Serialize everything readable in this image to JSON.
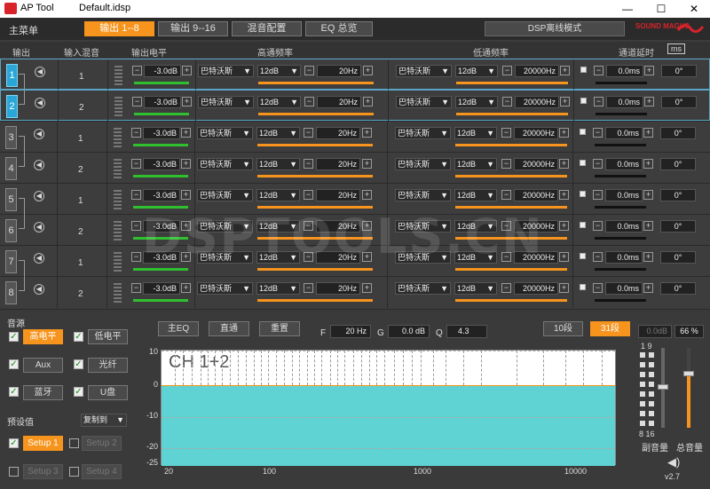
{
  "app": {
    "name": "AP Tool",
    "file": "Default.idsp"
  },
  "window": {
    "min": "—",
    "max": "☐",
    "close": "✕"
  },
  "menu": {
    "main": "主菜单",
    "tabs": [
      "输出 1--8",
      "输出 9--16",
      "混音配置",
      "EQ 总览"
    ],
    "dsp_mode": "DSP离线模式",
    "brand": "SOUND MAGUS"
  },
  "headers": {
    "out": "输出",
    "mix": "输入混音",
    "level": "输出电平",
    "hp": "高通频率",
    "lp": "低通频率",
    "delay": "通道延时",
    "unit": "ms"
  },
  "rows": [
    {
      "ch": "1",
      "mix": "1",
      "level": "-3.0dB",
      "hp_type": "巴特沃斯",
      "hp_slope": "12dB",
      "hp_freq": "20Hz",
      "lp_type": "巴特沃斯",
      "lp_slope": "12dB",
      "lp_freq": "20000Hz",
      "delay": "0.0ms",
      "phase": "0°"
    },
    {
      "ch": "2",
      "mix": "2",
      "level": "-3.0dB",
      "hp_type": "巴特沃斯",
      "hp_slope": "12dB",
      "hp_freq": "20Hz",
      "lp_type": "巴特沃斯",
      "lp_slope": "12dB",
      "lp_freq": "20000Hz",
      "delay": "0.0ms",
      "phase": "0°"
    },
    {
      "ch": "3",
      "mix": "1",
      "level": "-3.0dB",
      "hp_type": "巴特沃斯",
      "hp_slope": "12dB",
      "hp_freq": "20Hz",
      "lp_type": "巴特沃斯",
      "lp_slope": "12dB",
      "lp_freq": "20000Hz",
      "delay": "0.0ms",
      "phase": "0°"
    },
    {
      "ch": "4",
      "mix": "2",
      "level": "-3.0dB",
      "hp_type": "巴特沃斯",
      "hp_slope": "12dB",
      "hp_freq": "20Hz",
      "lp_type": "巴特沃斯",
      "lp_slope": "12dB",
      "lp_freq": "20000Hz",
      "delay": "0.0ms",
      "phase": "0°"
    },
    {
      "ch": "5",
      "mix": "1",
      "level": "-3.0dB",
      "hp_type": "巴特沃斯",
      "hp_slope": "12dB",
      "hp_freq": "20Hz",
      "lp_type": "巴特沃斯",
      "lp_slope": "12dB",
      "lp_freq": "20000Hz",
      "delay": "0.0ms",
      "phase": "0°"
    },
    {
      "ch": "6",
      "mix": "2",
      "level": "-3.0dB",
      "hp_type": "巴特沃斯",
      "hp_slope": "12dB",
      "hp_freq": "20Hz",
      "lp_type": "巴特沃斯",
      "lp_slope": "12dB",
      "lp_freq": "20000Hz",
      "delay": "0.0ms",
      "phase": "0°"
    },
    {
      "ch": "7",
      "mix": "1",
      "level": "-3.0dB",
      "hp_type": "巴特沃斯",
      "hp_slope": "12dB",
      "hp_freq": "20Hz",
      "lp_type": "巴特沃斯",
      "lp_slope": "12dB",
      "lp_freq": "20000Hz",
      "delay": "0.0ms",
      "phase": "0°"
    },
    {
      "ch": "8",
      "mix": "2",
      "level": "-3.0dB",
      "hp_type": "巴特沃斯",
      "hp_slope": "12dB",
      "hp_freq": "20Hz",
      "lp_type": "巴特沃斯",
      "lp_slope": "12dB",
      "lp_freq": "20000Hz",
      "delay": "0.0ms",
      "phase": "0°"
    }
  ],
  "watermark": "DSPTOOLS.CN",
  "source": {
    "title": "音源",
    "items": [
      "高电平",
      "低电平",
      "Aux",
      "光纤",
      "蓝牙",
      "U盘"
    ]
  },
  "preset": {
    "title": "预设值",
    "copy": "复制到",
    "setups": [
      "Setup 1",
      "Setup 2",
      "Setup 3",
      "Setup 4"
    ]
  },
  "eq": {
    "main": "主EQ",
    "bypass": "直通",
    "reset": "重置",
    "f_label": "F",
    "f_val": "20 Hz",
    "g_label": "G",
    "g_val": "0.0 dB",
    "q_label": "Q",
    "q_val": "4.3",
    "band10": "10段",
    "band31": "31段",
    "graph_title": "CH 1+2",
    "yticks": [
      "10",
      "0",
      "-10",
      "-20",
      "-25"
    ],
    "xticks": [
      "20",
      "100",
      "1000",
      "10000"
    ]
  },
  "right": {
    "db": "0.0dB",
    "pct": "66 %",
    "sub_label": "副音量",
    "main_label": "总音量",
    "version": "v2.7",
    "vu_top": "1 9",
    "vu_bot": "8 16"
  }
}
